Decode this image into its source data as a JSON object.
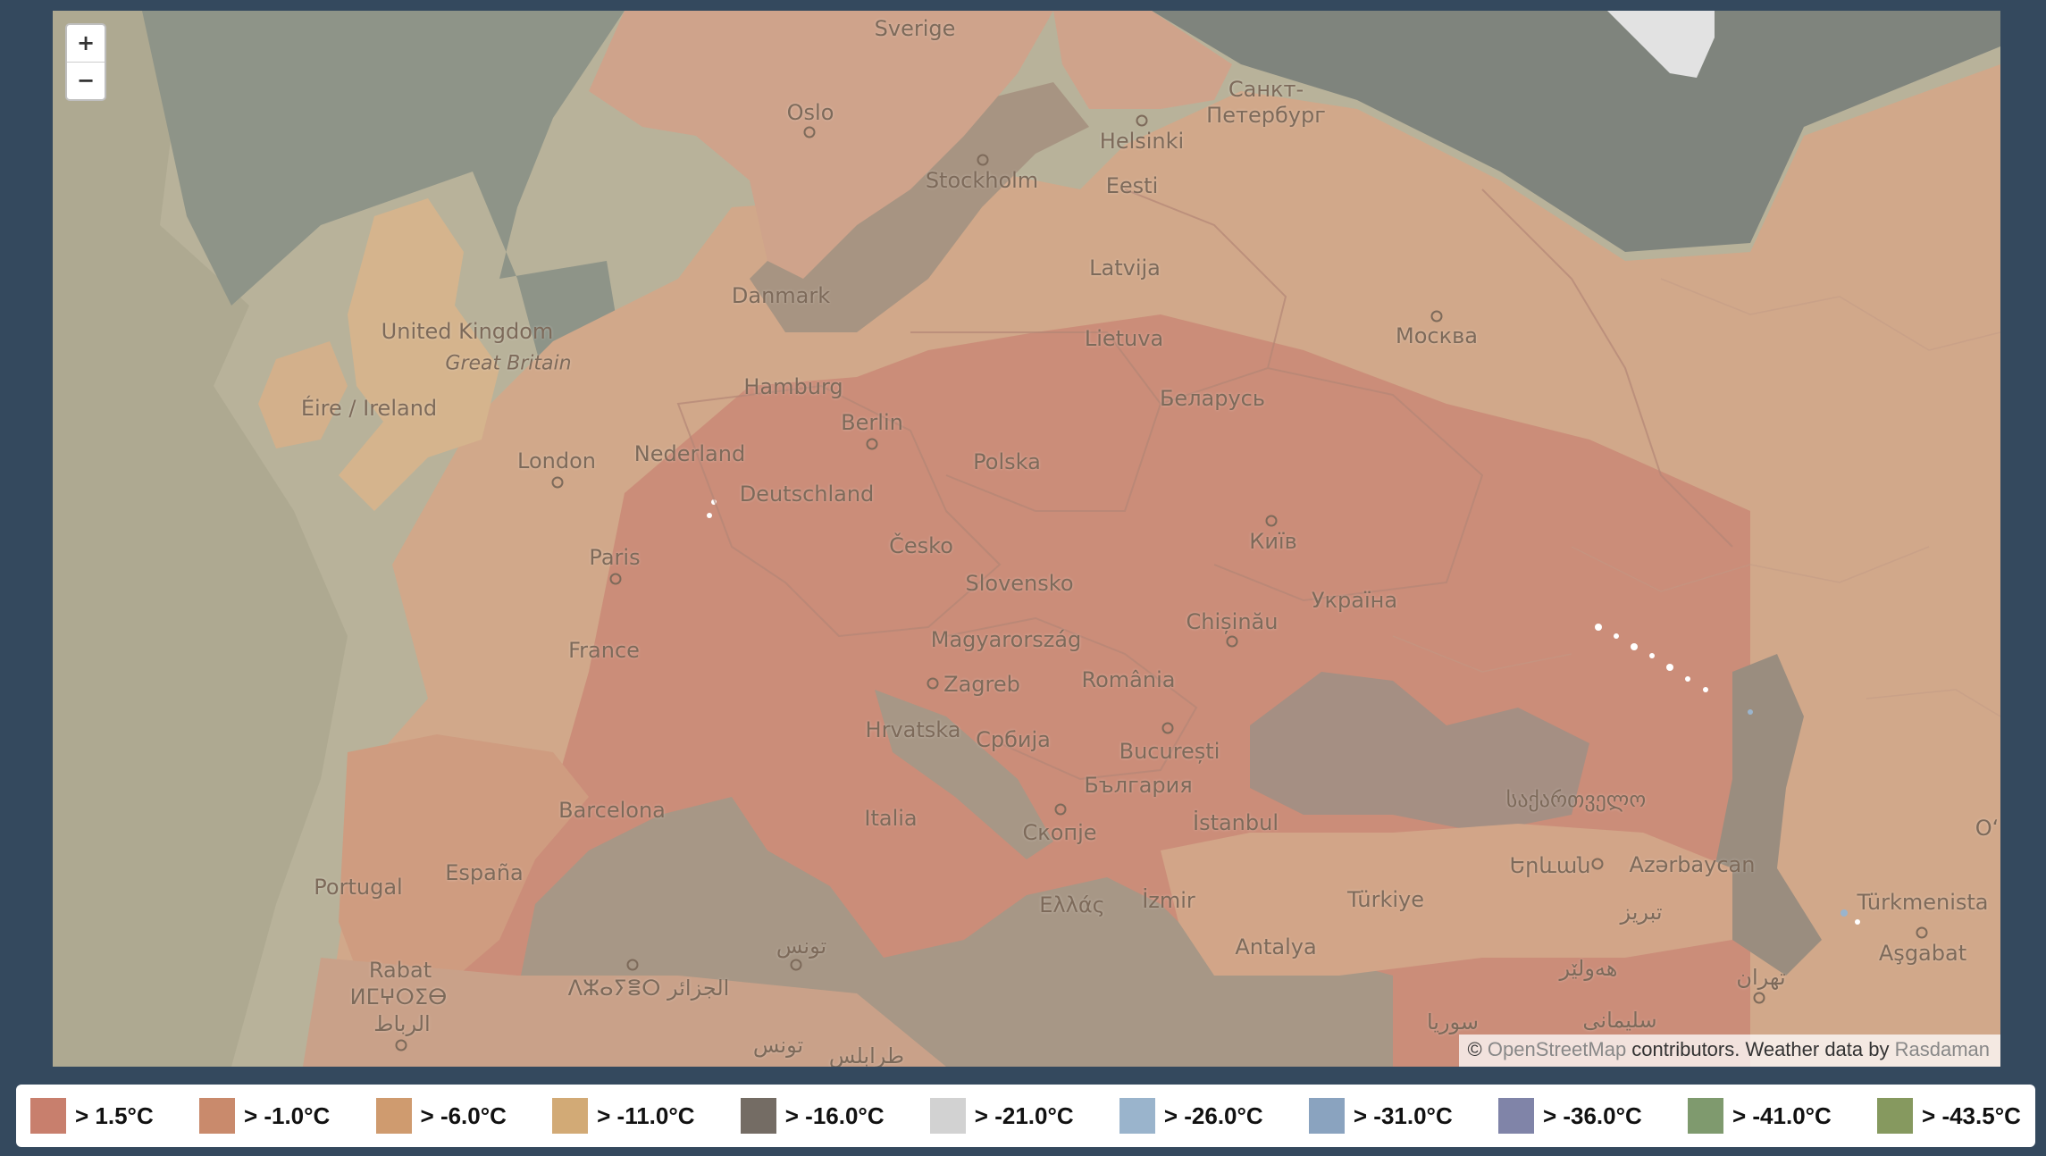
{
  "map": {
    "zoom_in": "+",
    "zoom_out": "−",
    "attribution": {
      "prefix": "© ",
      "osm_link": "OpenStreetMap",
      "middle": " contributors. Weather data by ",
      "rasdaman_link": "Rasdaman"
    },
    "labels": {
      "sverige": "Sverige",
      "oslo": "Oslo",
      "stockholm": "Stockholm",
      "helsinki": "Helsinki",
      "sankt_peterburg_1": "Санкт-",
      "sankt_peterburg_2": "Петербург",
      "eesti": "Eesti",
      "latvija": "Latvija",
      "danmark": "Danmark",
      "united_kingdom": "United Kingdom",
      "great_britain": "Great Britain",
      "eire": "Éire / Ireland",
      "hamburg": "Hamburg",
      "berlin": "Berlin",
      "lietuva": "Lietuva",
      "moskva": "Москва",
      "belarus": "Беларусь",
      "london": "London",
      "nederland": "Nederland",
      "deutschland": "Deutschland",
      "polska": "Polska",
      "cesko": "Česko",
      "kyiv": "Київ",
      "paris": "Paris",
      "slovensko": "Slovensko",
      "ukraina": "Україна",
      "chisinau": "Chișinău",
      "magyarorszag": "Magyarország",
      "france": "France",
      "zagreb": "Zagreb",
      "romania": "România",
      "hrvatska": "Hrvatska",
      "srbija": "Србија",
      "bucuresti": "București",
      "bulgaria": "България",
      "barcelona": "Barcelona",
      "italia": "Italia",
      "skopje": "Скопје",
      "istanbul": "İstanbul",
      "georgia": "საქართველო",
      "portugal": "Portugal",
      "espana": "España",
      "yerevan": "Երևան",
      "azerbaycan": "Azərbaycan",
      "ellada": "Ελλάς",
      "izmir": "İzmir",
      "turkiye": "Türkiye",
      "tabriz": "تبریز",
      "turkmenistan": "Türkmenista",
      "tunis": "تونس",
      "antalya": "Antalya",
      "rabat": "Rabat",
      "morocco_tif": "ⵍⵎⵖⵔⵉⴱ",
      "dzayer": "ⴷⵣⴰⵢⴻⵔ الجزائر",
      "asgabat": "Aşgabat",
      "rabat_ar": "الرباط",
      "tunis2": "تونس",
      "tarabulus": "طرابلس",
      "suriya": "سوريا",
      "tehran": "تهران",
      "mosul": "هەولێر",
      "sulaymaniyah": "سليمانی",
      "o_edge": "Oʻ"
    }
  },
  "legend": [
    {
      "label": "> 1.5°C",
      "color": "#c87f6d"
    },
    {
      "label": "> -1.0°C",
      "color": "#c98a6c"
    },
    {
      "label": "> -6.0°C",
      "color": "#cf9b6f"
    },
    {
      "label": "> -11.0°C",
      "color": "#d2aa76"
    },
    {
      "label": "> -16.0°C",
      "color": "#746c64"
    },
    {
      "label": "> -21.0°C",
      "color": "#d2d2d2"
    },
    {
      "label": "> -26.0°C",
      "color": "#9ab4cc"
    },
    {
      "label": "> -31.0°C",
      "color": "#8aa3bf"
    },
    {
      "label": "> -36.0°C",
      "color": "#8084a8"
    },
    {
      "label": "> -41.0°C",
      "color": "#7f9a6e"
    },
    {
      "label": "> -43.5°C",
      "color": "#86995f"
    }
  ]
}
